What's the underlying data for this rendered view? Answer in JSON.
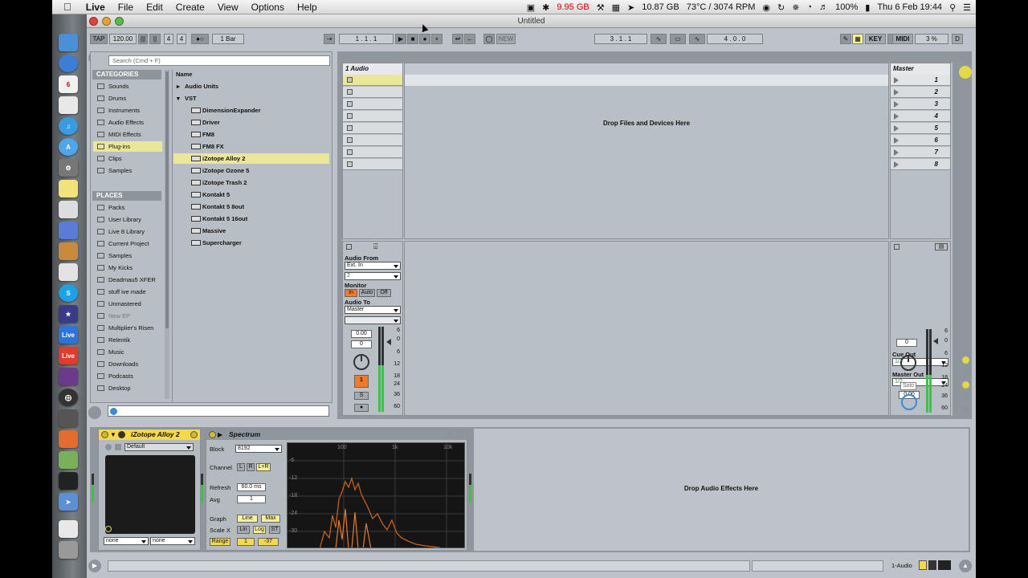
{
  "menubar": {
    "apple": "",
    "app_name": "Live",
    "menus": [
      "File",
      "Edit",
      "Create",
      "View",
      "Options",
      "Help"
    ],
    "status": {
      "memory": "9.95 GB",
      "disk": "10.87 GB",
      "temp": "73°C / 3074 RPM",
      "battery": "100%",
      "datetime": "Thu 6 Feb  19:44"
    }
  },
  "window": {
    "title": "Untitled"
  },
  "transport": {
    "tap": "TAP",
    "tempo": "120.00",
    "signature_num": "4",
    "signature_den": "4",
    "quantize": "1 Bar",
    "position": "1 .  1 .  1",
    "new": "NEW",
    "loop_start": "3 .  1 .  1",
    "loop_length": "4 .  0 .  0",
    "key": "KEY",
    "midi": "MIDI",
    "cpu": "3 %",
    "d": "D"
  },
  "browser": {
    "search_placeholder": "Search (Cmd + F)",
    "categories_header": "CATEGORIES",
    "categories": [
      "Sounds",
      "Drums",
      "Instruments",
      "Audio Effects",
      "MIDI Effects",
      "Plug-ins",
      "Clips",
      "Samples"
    ],
    "selected_category": "Plug-ins",
    "places_header": "PLACES",
    "places": [
      "Packs",
      "User Library",
      "Live 8 Library",
      "Current Project",
      "Samples",
      "My Kicks",
      "Deadmau5 XFER",
      "stuff ive made",
      "Unmastered",
      "New EP",
      "Multiplier's Risen",
      "Relentik",
      "Music",
      "Downloads",
      "Podcasts",
      "Desktop"
    ],
    "name_header": "Name",
    "folders": [
      "Audio Units",
      "VST"
    ],
    "plugins": [
      "DimensionExpander",
      "Driver",
      "FM8",
      "FM8 FX",
      "iZotope Alloy 2",
      "iZotope Ozone 5",
      "iZotope Trash 2",
      "Kontakt 5",
      "Kontakt 5 8out",
      "Kontakt 5 16out",
      "Massive",
      "Supercharger"
    ],
    "selected_plugin": "iZotope Alloy 2"
  },
  "session": {
    "track_name": "1 Audio",
    "master_name": "Master",
    "drop_text": "Drop Files and Devices Here",
    "scenes": [
      "1",
      "2",
      "3",
      "4",
      "5",
      "6",
      "7",
      "8"
    ],
    "audio_from_label": "Audio From",
    "audio_from": "Ext. In",
    "input_channel": "2",
    "monitor_label": "Monitor",
    "monitor_in": "In",
    "monitor_auto": "Auto",
    "monitor_off": "Off",
    "audio_to_label": "Audio To",
    "audio_to": "Master",
    "volume": "0.00",
    "pan": "0",
    "track_number": "1",
    "solo": "S",
    "cue_out_label": "Cue Out",
    "cue_out": "1/2",
    "master_out_label": "Master Out",
    "master_out": "1/2",
    "master_volume": "0.00",
    "master_pan": "0",
    "master_solo": "Solo",
    "meter_scale": [
      "6",
      "0",
      "6",
      "12",
      "18",
      "24",
      "36",
      "60"
    ],
    "track_meter_level": 0.55,
    "master_meter_level": 0.45
  },
  "devices": {
    "alloy": {
      "name": "iZotope Alloy 2",
      "preset": "Default",
      "left_select": "none",
      "right_select": "none"
    },
    "spectrum": {
      "name": "Spectrum",
      "block_label": "Block",
      "block": "8192",
      "channel_label": "Channel",
      "ch_l": "L",
      "ch_r": "R",
      "ch_lr": "L+R",
      "refresh_label": "Refresh",
      "refresh": "60.0 ms",
      "avg_label": "Avg",
      "avg": "1",
      "graph_label": "Graph",
      "graph_line": "Line",
      "graph_max": "Max",
      "scalex_label": "Scale X",
      "scale_lin": "Lin",
      "scale_log": "Log",
      "scale_st": "ST",
      "range_label": "Range",
      "range_hi": "1",
      "range_lo": "-37",
      "freq_labels": [
        "100",
        "1k",
        "10k"
      ],
      "db_labels": [
        "-6",
        "-12",
        "-18",
        "-24",
        "-30"
      ]
    },
    "drop_text": "Drop Audio Effects Here"
  },
  "statusbar": {
    "track_label": "1-Audio"
  }
}
